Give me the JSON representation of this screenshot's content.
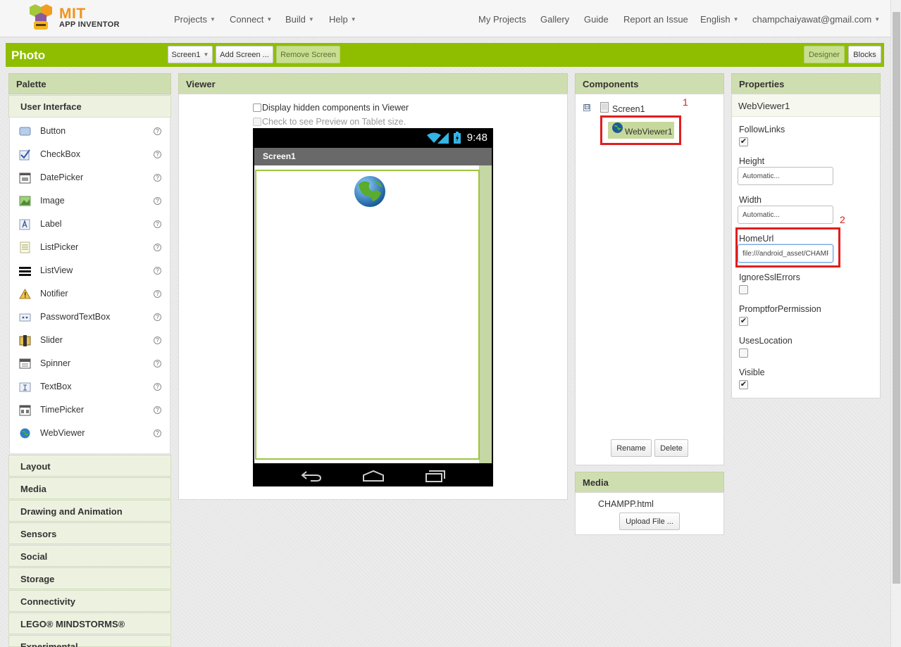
{
  "app": {
    "logo_main": "MIT",
    "logo_sub": "APP INVENTOR"
  },
  "nav": {
    "left": [
      "Projects",
      "Connect",
      "Build",
      "Help"
    ],
    "right": {
      "my_projects": "My Projects",
      "gallery": "Gallery",
      "guide": "Guide",
      "report": "Report an Issue",
      "language": "English",
      "account": "champchaiyawat@gmail.com"
    }
  },
  "toolbar": {
    "project_title": "Photo",
    "screen_select": "Screen1",
    "add_screen": "Add Screen ...",
    "remove_screen": "Remove Screen",
    "designer": "Designer",
    "blocks": "Blocks"
  },
  "palette": {
    "title": "Palette",
    "open_category": "User Interface",
    "help_symbol": "?",
    "items": [
      {
        "label": "Button",
        "icon": "button-icon"
      },
      {
        "label": "CheckBox",
        "icon": "checkbox-icon"
      },
      {
        "label": "DatePicker",
        "icon": "datepicker-icon"
      },
      {
        "label": "Image",
        "icon": "image-icon"
      },
      {
        "label": "Label",
        "icon": "label-icon"
      },
      {
        "label": "ListPicker",
        "icon": "listpicker-icon"
      },
      {
        "label": "ListView",
        "icon": "listview-icon"
      },
      {
        "label": "Notifier",
        "icon": "notifier-icon"
      },
      {
        "label": "PasswordTextBox",
        "icon": "password-icon"
      },
      {
        "label": "Slider",
        "icon": "slider-icon"
      },
      {
        "label": "Spinner",
        "icon": "spinner-icon"
      },
      {
        "label": "TextBox",
        "icon": "textbox-icon"
      },
      {
        "label": "TimePicker",
        "icon": "timepicker-icon"
      },
      {
        "label": "WebViewer",
        "icon": "webviewer-icon"
      }
    ],
    "categories": [
      "Layout",
      "Media",
      "Drawing and Animation",
      "Sensors",
      "Social",
      "Storage",
      "Connectivity",
      "LEGO® MINDSTORMS®",
      "Experimental"
    ]
  },
  "viewer": {
    "title": "Viewer",
    "show_hidden": "Display hidden components in Viewer",
    "tablet_preview": "Check to see Preview on Tablet size.",
    "phone_time": "9:48",
    "screen_title": "Screen1"
  },
  "components": {
    "title": "Components",
    "root": "Screen1",
    "toggle": "⊟",
    "child": "WebViewer1",
    "rename": "Rename",
    "delete": "Delete",
    "annotation": "1"
  },
  "media": {
    "title": "Media",
    "file": "CHAMPP.html",
    "upload": "Upload File ..."
  },
  "properties": {
    "title": "Properties",
    "component": "WebViewer1",
    "follow_links": {
      "label": "FollowLinks",
      "checked": true
    },
    "height": {
      "label": "Height",
      "value": "Automatic..."
    },
    "width": {
      "label": "Width",
      "value": "Automatic..."
    },
    "home_url": {
      "label": "HomeUrl",
      "value": "file:///android_asset/CHAMPP.html"
    },
    "ignore_ssl": {
      "label": "IgnoreSslErrors",
      "checked": false
    },
    "prompt_permission": {
      "label": "PromptforPermission",
      "checked": true
    },
    "uses_location": {
      "label": "UsesLocation",
      "checked": false
    },
    "visible": {
      "label": "Visible",
      "checked": true
    },
    "annotation": "2",
    "check_symbol": "✔"
  },
  "colors": {
    "brand_green": "#8fbe01",
    "panel_header": "#cfdeb0",
    "annotation_red": "#e01e1e",
    "logo_orange": "#f0931b"
  }
}
